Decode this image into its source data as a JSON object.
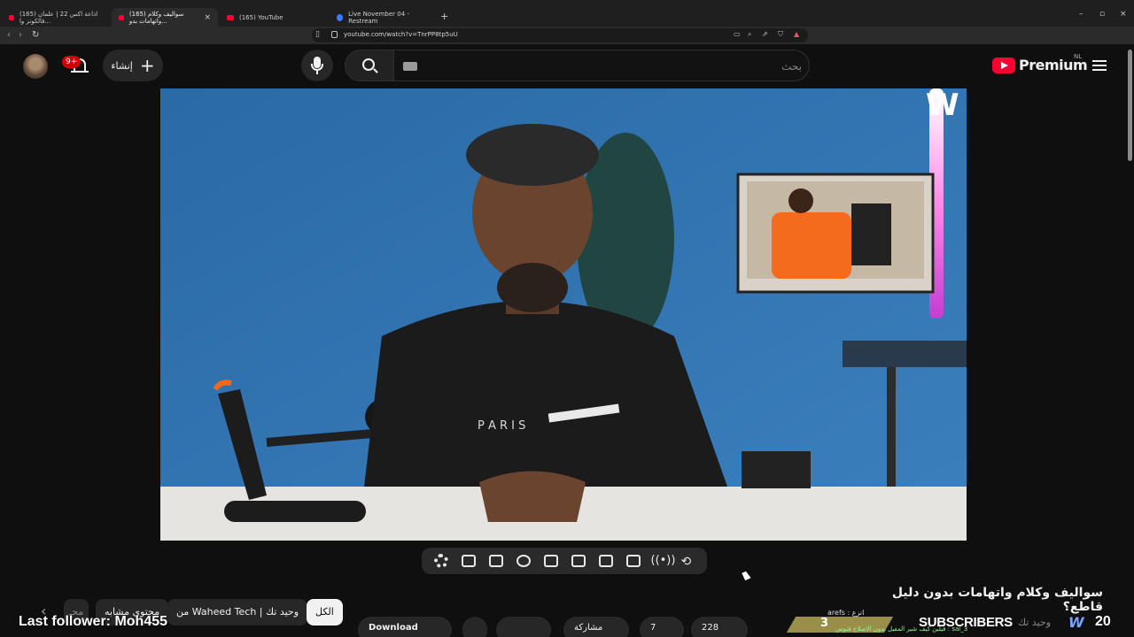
{
  "browser": {
    "tabs": [
      {
        "title": "(165) اذاعة اكس 22 | علمان فالكونز وا...",
        "icon": "youtube-icon",
        "active": false
      },
      {
        "title": "(165) سواليف وكلام واتهامات بدو...",
        "icon": "youtube-icon",
        "active": true
      },
      {
        "title": "(165) YouTube",
        "icon": "youtube-icon",
        "active": false
      },
      {
        "title": "Live November 04 - Restream",
        "icon": "restream-icon",
        "active": false
      }
    ],
    "tab_close_glyph": "×",
    "new_tab_glyph": "+",
    "window_controls": [
      "–",
      "▫",
      "×"
    ],
    "url": "youtube.com/watch?v=TnrPP8tp5uU"
  },
  "masthead": {
    "notification_count": "9+",
    "create_label": "إنشاء",
    "search_placeholder": "بحث",
    "logo_text": "Premium",
    "country_code": "NL"
  },
  "player": {
    "toolbar_icons": [
      "settings-icon",
      "screenshot-icon",
      "add-clip-icon",
      "speed-icon",
      "theater-icon",
      "fullscreen-icon",
      "clapperboard-icon",
      "watch-icon",
      "broadcast-icon",
      "loop-icon"
    ]
  },
  "video": {
    "title": "سواليف وكلام واتهامات بدون دليل قاطع؟"
  },
  "chips": {
    "all": "الكل",
    "from_channel": "من Waheed Tech | وحيد تك",
    "related": "محتوى مشابه",
    "partial": "محـ"
  },
  "actions": {
    "download": "Download",
    "likes": "228",
    "comments": "7",
    "share": "مشاركة"
  },
  "overlay": {
    "last_follower": "Last follower: Moh455",
    "sub_name": "arefs : انزع",
    "sub_ticker": "3_sai : فيلين كيف شير المفيل بدون الاصلاح قنوس",
    "sub_small_count": "3",
    "sub_label": "SUBSCRIBERS",
    "sub_channel": "وحيد تك",
    "sub_count": "20",
    "brand_mark": "W"
  },
  "colors": {
    "background": "#0f0f0f",
    "accent_red": "#ff0033",
    "video_backdrop": "#2f6fa8"
  }
}
